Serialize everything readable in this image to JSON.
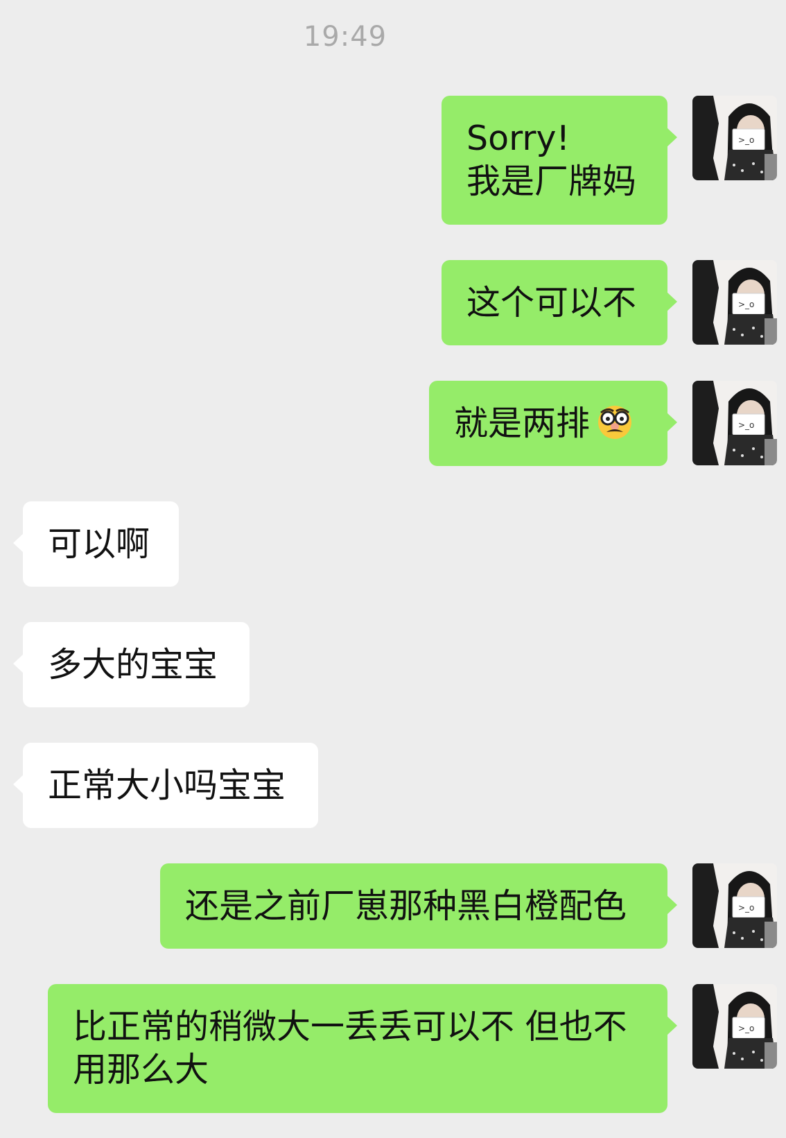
{
  "chat": {
    "timestamp": "19:49",
    "messages": [
      {
        "id": "m1",
        "side": "out",
        "text": "Sorry!\n我是厂牌妈"
      },
      {
        "id": "m2",
        "side": "out",
        "text": "这个可以不"
      },
      {
        "id": "m3",
        "side": "out",
        "text": "就是两排",
        "emoji": "disguised-face-emoji"
      },
      {
        "id": "m4",
        "side": "in",
        "text": "可以啊"
      },
      {
        "id": "m5",
        "side": "in",
        "text": "多大的宝宝"
      },
      {
        "id": "m6",
        "side": "in",
        "text": "正常大小吗宝宝"
      },
      {
        "id": "m7",
        "side": "out",
        "text": "还是之前厂崽那种黑白橙配色"
      },
      {
        "id": "m8",
        "side": "out",
        "text": "比正常的稍微大一丢丢可以不 但也不\n用那么大"
      }
    ]
  },
  "colors": {
    "background": "#ededed",
    "outgoing_bubble": "#95ec69",
    "incoming_bubble": "#ffffff",
    "timestamp_text": "#a9a9a9"
  }
}
